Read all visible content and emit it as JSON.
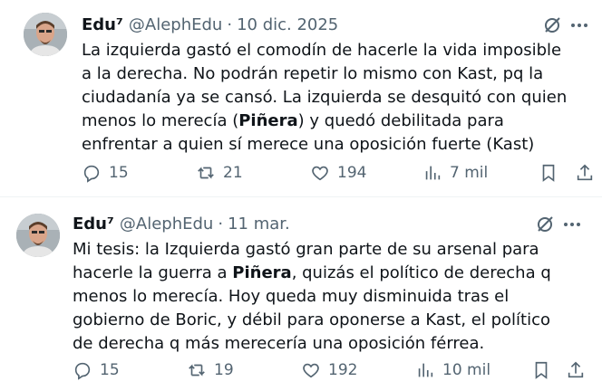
{
  "colors": {
    "text": "#0f1419",
    "muted": "#536471",
    "divider": "#eff3f4"
  },
  "tweets": [
    {
      "author_name": "Edu⁷",
      "handle": "@AlephEdu",
      "separator": "·",
      "date": "10 dic. 2025",
      "lines": [
        "La izquierda gastó el comodín de hacerle la vida imposible",
        "a la derecha. No podrán repetir lo mismo con Kast, pq la",
        "ciudadanía ya se cansó. La izquierda se desquitó con quien",
        "menos lo merecía (",
        "Piñera",
        ") y quedó debilitada para",
        "enfrentar a quien sí merece una oposición fuerte (Kast)"
      ],
      "stats": {
        "replies": "15",
        "reposts": "21",
        "likes": "194",
        "views": "7 mil"
      },
      "icons": [
        "grok-icon",
        "more-icon",
        "reply-icon",
        "retweet-icon",
        "like-icon",
        "views-icon",
        "bookmark-icon",
        "share-icon"
      ]
    },
    {
      "author_name": "Edu⁷",
      "handle": "@AlephEdu",
      "separator": "·",
      "date": "11 mar.",
      "lines": [
        "Mi tesis: la Izquierda gastó gran parte de su arsenal para",
        "hacerle la guerra a ",
        "Piñera",
        ", quizás el político de derecha q",
        "menos lo merecía. Hoy queda muy disminuida tras el",
        "gobierno de Boric, y débil para oponerse a Kast, el político",
        "de derecha q más merecería una oposición férrea."
      ],
      "stats": {
        "replies": "15",
        "reposts": "19",
        "likes": "192",
        "views": "10 mil"
      },
      "icons": [
        "grok-icon",
        "more-icon",
        "reply-icon",
        "retweet-icon",
        "like-icon",
        "views-icon",
        "bookmark-icon",
        "share-icon"
      ]
    }
  ]
}
